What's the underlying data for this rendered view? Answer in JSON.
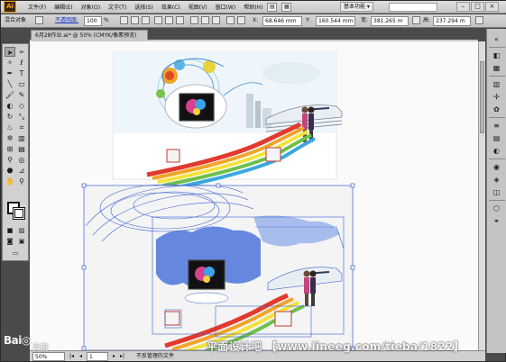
{
  "app": {
    "logo": "Ai"
  },
  "menubar": {
    "items": [
      "文件(F)",
      "编辑(E)",
      "对象(O)",
      "文字(T)",
      "选择(S)",
      "效果(C)",
      "视图(V)",
      "窗口(W)",
      "帮助(H)"
    ],
    "workspace": "基本功能 ▾"
  },
  "controlbar": {
    "mixed_objects": "混合对象",
    "opacity_label": "不透明度:",
    "opacity_value": "100",
    "opacity_unit": "%",
    "x_label": "X:",
    "x_value": "68.646 mm",
    "y_label": "Y:",
    "y_value": "160.544 mm",
    "w_label": "宽:",
    "w_value": "381.265 m",
    "h_label": "高:",
    "h_value": "237.294 m"
  },
  "document": {
    "tab_title": "6月28作业.ai* @ 50% (CMYK/像素预览)"
  },
  "statusbar": {
    "zoom": "50%",
    "page": "1",
    "status_text": "不反管理的文件"
  },
  "watermark": {
    "baidu": "Bai◎",
    "baidu_sub": "百度",
    "site": "平面设计吧 【www.lineeg.com/tieba/1822】"
  },
  "colors": {
    "accent_orange": "#f7a21b",
    "selection_blue": "#3a5fd0",
    "link_blue": "#1a38c8"
  },
  "icons": {
    "tools": [
      "selection-tool-icon",
      "direct-selection-tool-icon",
      "magic-wand-tool-icon",
      "lasso-tool-icon",
      "pen-tool-icon",
      "type-tool-icon",
      "line-tool-icon",
      "rectangle-tool-icon",
      "paintbrush-tool-icon",
      "pencil-tool-icon",
      "blob-brush-tool-icon",
      "eraser-tool-icon",
      "rotate-tool-icon",
      "scale-tool-icon",
      "warp-tool-icon",
      "free-transform-tool-icon",
      "symbol-sprayer-tool-icon",
      "graph-tool-icon",
      "mesh-tool-icon",
      "gradient-tool-icon",
      "eyedropper-tool-icon",
      "blend-tool-icon",
      "live-paint-tool-icon",
      "slice-tool-icon",
      "hand-tool-icon",
      "zoom-tool-icon"
    ]
  }
}
